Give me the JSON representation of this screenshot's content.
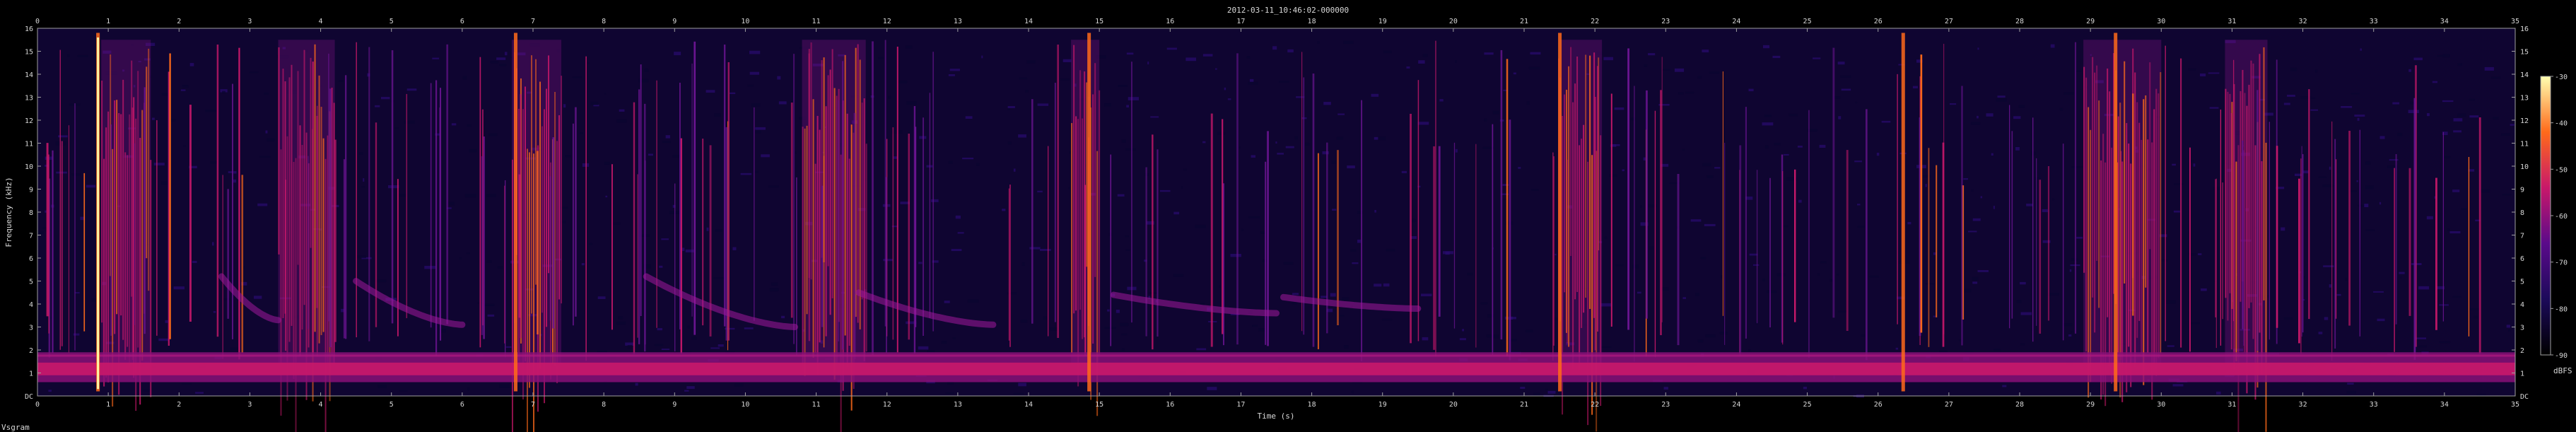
{
  "chart_data": {
    "type": "heatmap",
    "title": "2012-03-11_10:46:02-000000",
    "xlabel": "Time (s)",
    "ylabel": "Frequency (kHz)",
    "xlim": [
      0,
      35
    ],
    "ylim": [
      0,
      16
    ],
    "x_ticks": [
      "0",
      "1",
      "2",
      "3",
      "4",
      "5",
      "6",
      "7",
      "8",
      "9",
      "10",
      "11",
      "12",
      "13",
      "14",
      "15",
      "16",
      "17",
      "18",
      "19",
      "20",
      "21",
      "22",
      "23",
      "24",
      "25",
      "26",
      "27",
      "28",
      "29",
      "30",
      "31",
      "32",
      "33",
      "34",
      "35"
    ],
    "y_ticks": [
      "DC",
      "1",
      "2",
      "3",
      "4",
      "5",
      "6",
      "7",
      "8",
      "9",
      "10",
      "11",
      "12",
      "13",
      "14",
      "15",
      "16"
    ],
    "colorbar": {
      "label": "dBFS",
      "ticks": [
        "-30",
        "-40",
        "-50",
        "-60",
        "-70",
        "-80",
        "-90"
      ],
      "range": [
        -90,
        -30
      ]
    },
    "watermark": "Vsgram",
    "background_band_khz": [
      0.6,
      1.9
    ],
    "strong_broadband_events_s": [
      0.85,
      6.75,
      26.35,
      29.35,
      21.5,
      14.85
    ],
    "clustered_events": [
      {
        "start_s": 0.9,
        "end_s": 1.6
      },
      {
        "start_s": 3.4,
        "end_s": 4.2
      },
      {
        "start_s": 6.7,
        "end_s": 7.4
      },
      {
        "start_s": 10.8,
        "end_s": 11.7
      },
      {
        "start_s": 14.6,
        "end_s": 15.0
      },
      {
        "start_s": 21.5,
        "end_s": 22.1
      },
      {
        "start_s": 28.9,
        "end_s": 30.0
      },
      {
        "start_s": 30.9,
        "end_s": 31.5
      }
    ],
    "downward_sweeps": [
      {
        "start_s": 2.6,
        "end_s": 3.4,
        "f_start_khz": 5.2,
        "f_end_khz": 3.3
      },
      {
        "start_s": 4.5,
        "end_s": 6.0,
        "f_start_khz": 5.0,
        "f_end_khz": 3.1
      },
      {
        "start_s": 8.6,
        "end_s": 10.7,
        "f_start_khz": 5.2,
        "f_end_khz": 3.0
      },
      {
        "start_s": 11.6,
        "end_s": 13.5,
        "f_start_khz": 4.5,
        "f_end_khz": 3.1
      },
      {
        "start_s": 15.2,
        "end_s": 17.5,
        "f_start_khz": 4.4,
        "f_end_khz": 3.6
      },
      {
        "start_s": 17.6,
        "end_s": 19.5,
        "f_start_khz": 4.3,
        "f_end_khz": 3.8
      }
    ],
    "colors": {
      "background": "#000000",
      "noise": "#1c0a5a",
      "band": "#c8186a",
      "hot": "#ff6a1a",
      "peak": "#ffffb0",
      "axis": "#a0a0a0"
    }
  }
}
